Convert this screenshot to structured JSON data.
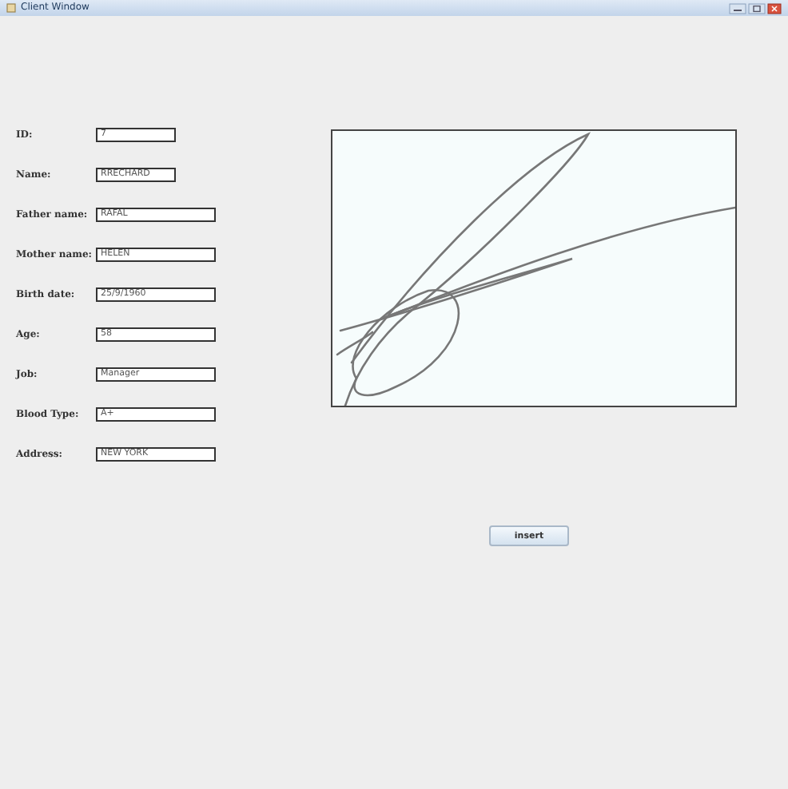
{
  "window": {
    "title": "Client Window"
  },
  "fields": [
    {
      "label": "ID:",
      "value": "7"
    },
    {
      "label": "Name:",
      "value": "RRECHARD"
    },
    {
      "label": "Father name:",
      "value": "RAFAL"
    },
    {
      "label": "Mother name:",
      "value": "HELEN"
    },
    {
      "label": "Birth date:",
      "value": "25/9/1960"
    },
    {
      "label": "Age:",
      "value": "58"
    },
    {
      "label": "Job:",
      "value": "Manager"
    },
    {
      "label": "Blood Type:",
      "value": "A+"
    },
    {
      "label": "Address:",
      "value": "NEW YORK"
    }
  ],
  "insert_button": "insert"
}
